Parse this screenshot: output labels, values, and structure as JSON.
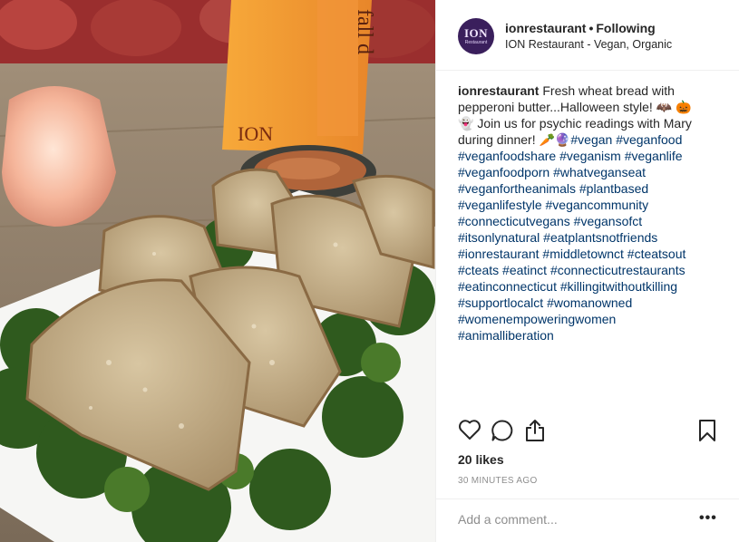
{
  "post": {
    "image_alt": "Plate of wheat bread slices on kale with a dip bowl, salt lamp and ION menu",
    "menu_logo_text": "ION",
    "menu_side_text": "fall d"
  },
  "header": {
    "avatar_text": "ION",
    "avatar_subtext": "Restaurant",
    "username": "ionrestaurant",
    "separator": "•",
    "follow_status": "Following",
    "location": "ION Restaurant - Vegan, Organic"
  },
  "caption": {
    "username": "ionrestaurant",
    "text": "Fresh wheat bread with pepperoni butter...Halloween style! 🦇 🎃 👻 Join us for psychic readings with Mary during dinner! 🥕🔮",
    "hashtags": [
      "#vegan",
      "#veganfood",
      "#veganfoodshare",
      "#veganism",
      "#veganlife",
      "#veganfoodporn",
      "#whatveganseat",
      "#veganfortheanimals",
      "#plantbased",
      "#veganlifestyle",
      "#vegancommunity",
      "#connecticutvegans",
      "#vegansofct",
      "#itsonlynatural",
      "#eatplantsnotfriends",
      "#ionrestaurant",
      "#middletownct",
      "#cteatsout",
      "#cteats",
      "#eatinct",
      "#connecticutrestaurants",
      "#eatinconnecticut",
      "#killingitwithoutkilling",
      "#supportlocalct",
      "#womanowned",
      "#womenempoweringwomen",
      "#animalliberation"
    ]
  },
  "actions": {
    "like_icon": "heart-icon",
    "comment_icon": "comment-icon",
    "share_icon": "share-icon",
    "save_icon": "bookmark-icon"
  },
  "likes": "20 likes",
  "timestamp": "30 MINUTES AGO",
  "comment": {
    "placeholder": "Add a comment...",
    "more_label": "•••"
  },
  "colors": {
    "hashtag": "#003569",
    "menu_orange": "#f49a2a",
    "avatar_purple": "#3a1f5c"
  }
}
